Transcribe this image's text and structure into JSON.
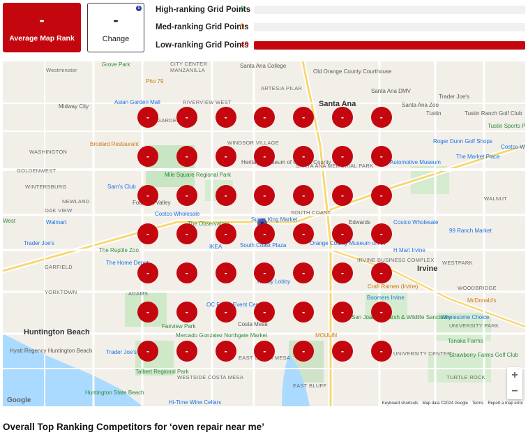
{
  "kpis": {
    "average_map_rank": {
      "value": "-",
      "label": "Average Map Rank"
    },
    "change": {
      "value": "-",
      "label": "Change",
      "info_icon": "info-icon"
    }
  },
  "stats": [
    {
      "label": "High-ranking Grid Points",
      "count": "0",
      "color": "#2e9e4e",
      "fraction": 0
    },
    {
      "label": "Med-ranking Grid Points",
      "count": "0",
      "color": "#e0701b",
      "fraction": 0
    },
    {
      "label": "Low-ranking Grid Points",
      "count": "49",
      "color": "#c4070e",
      "fraction": 1
    }
  ],
  "map": {
    "grid_pin_label": "-",
    "grid_rows": 7,
    "grid_cols": 7,
    "places": {
      "westminster": "Westminster",
      "grove_park": "Grove Park",
      "city_center": "CITY CENTER",
      "manzanilla": "MANZANILLA",
      "santa_ana_college": "Santa Ana College",
      "old_orange_county_courthouse": "Old Orange County Courthouse",
      "pho_79": "Pho 79",
      "artesia_pilar": "ARTESIA PILAR",
      "santa_ana_dmv": "Santa Ana DMV",
      "trader_joes_1": "Trader Joe's",
      "midway_city": "Midway City",
      "asian_garden_mall": "Asian Garden Mall",
      "riverview_west": "RIVERVIEW WEST",
      "santa_ana": "Santa Ana",
      "santa_ana_zoo": "Santa Ana Zoo",
      "tustin": "Tustin",
      "tustin_ranch_golf_club": "Tustin Ranch Golf Club",
      "west_garden_grove": "WEST GARDEN",
      "tustin_sports_park": "Tustin Sports Park",
      "brodard_restaurant": "Brodard Restaurant",
      "washington": "WASHINGTON",
      "windsor_village": "WINDSOR VILLAGE",
      "heritage_museum": "Heritage Museum of Orange County",
      "santa_ana_memorial_park": "SANTA ANA MEMORIAL PARK",
      "automotive_museum": "Automotive Museum",
      "roger_dunn": "Roger Dunn Golf Shops",
      "costco_1": "Costco Wh",
      "market_place": "The Market Place",
      "goldenwest": "GOLDENWEST",
      "mile_square": "Mile Square Regional Park",
      "wintersburg": "WINTERSBURG",
      "sams_club": "Sam's Club",
      "fountain_valley": "Fountain Valley",
      "newland": "NEWLAND",
      "oak_view": "OAK VIEW",
      "costco_2": "Costco Wholesale",
      "south_coast": "SOUTH COAST",
      "walnut": "WALNUT",
      "walmart": "Walmart",
      "west": "West",
      "super_king_market": "Super King Market",
      "the_observatory": "The Observatory",
      "edwards": "Edwards",
      "costco_3": "Costco Wholesale",
      "ranch_market": "99 Ranch Market",
      "trader_joes_2": "Trader Joe's",
      "reptile_zoo": "The Reptile Zoo",
      "ikea": "IKEA",
      "south_coast_plaza": "South Coast Plaza",
      "ocma": "Orange County Museum of Art",
      "h_mart": "H Mart Irvine",
      "home_depot": "The Home Depot",
      "garfield": "GARFIELD",
      "irvine_business_complex": "IRVINE BUSINESS COMPLEX",
      "irvine": "Irvine",
      "westpark": "WESTPARK",
      "yorktown": "YORKTOWN",
      "adams": "ADAMS",
      "hobby_lobby": "Hobby Lobby",
      "craft_ramen": "Craft Ramen (Irvine)",
      "woodbridge": "WOODBRIDGE",
      "boomers": "Boomers Irvine",
      "mcdonalds": "McDonald's",
      "oc_event_center": "OC Fair & Event Center",
      "costa_mesa": "Costa Mesa",
      "fairview_park": "Fairview Park",
      "san_joaquin": "San Joaquin Marsh & Wildlife Sanctuary",
      "wholesome_choice": "Wholesome Choice",
      "university_park": "UNIVERSITY PARK",
      "huntington_beach": "Huntington Beach",
      "mercado": "Mercado Gonzalez Northgate Market",
      "moulin": "MOULIN",
      "tanaka_farms": "Tanaka Farms",
      "hyatt": "Hyatt Regency Huntington Beach",
      "trader_joes_3": "Trader Joe's",
      "east_costa_mesa": "EAST COSTA MESA",
      "university_center": "UNIVERSITY CENTER",
      "strawberry_farms": "Strawberry Farms Golf Club",
      "talbert_park": "Talbert Regional Park",
      "westside_costa_mesa": "WESTSIDE COSTA MESA",
      "turtle_rock": "TURTLE ROCK",
      "east_bluff": "EAST BLUFF",
      "state_beach": "Huntington State Beach",
      "hi_time": "Hi-Time Wine Cellars"
    },
    "google_logo": "Google",
    "attribution": {
      "keyboard": "Keyboard shortcuts",
      "map_data": "Map data ©2024 Google",
      "terms": "Terms",
      "report": "Report a map error"
    },
    "zoom_in": "+",
    "zoom_out": "−"
  },
  "section_heading": "Overall Top Ranking Competitors for ‘oven repair near me’"
}
